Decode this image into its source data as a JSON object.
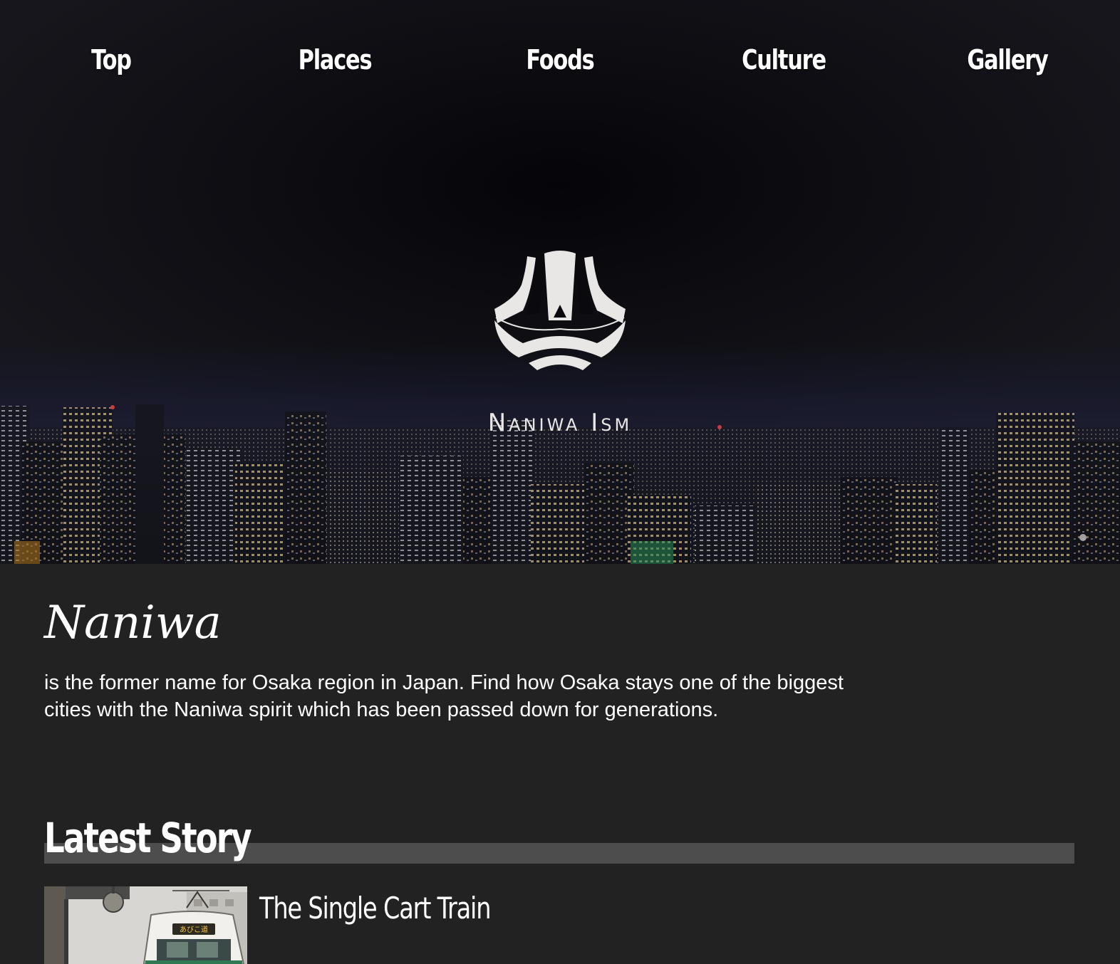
{
  "nav": {
    "items": [
      {
        "label": "Top"
      },
      {
        "label": "Places"
      },
      {
        "label": "Foods"
      },
      {
        "label": "Culture"
      },
      {
        "label": "Gallery"
      }
    ]
  },
  "hero": {
    "logo_icon": "naniwa-ism-emblem-icon",
    "logo_text": "Naniwa Ism",
    "logo_color": "#e9e6e6"
  },
  "intro": {
    "title": "Naniwa",
    "text": "is the former name for Osaka region in Japan. Find how Osaka stays one of the biggest cities with the Naniwa spirit which has been passed down for generations."
  },
  "latest": {
    "heading": "Latest Story",
    "stories": [
      {
        "title": "The Single Cart Train",
        "thumbnail": "tram-photo",
        "sign_text": "あびこ道"
      }
    ]
  },
  "colors": {
    "page_background": "#222222",
    "section_bar": "#4d4d4d",
    "text": "#ffffff"
  }
}
